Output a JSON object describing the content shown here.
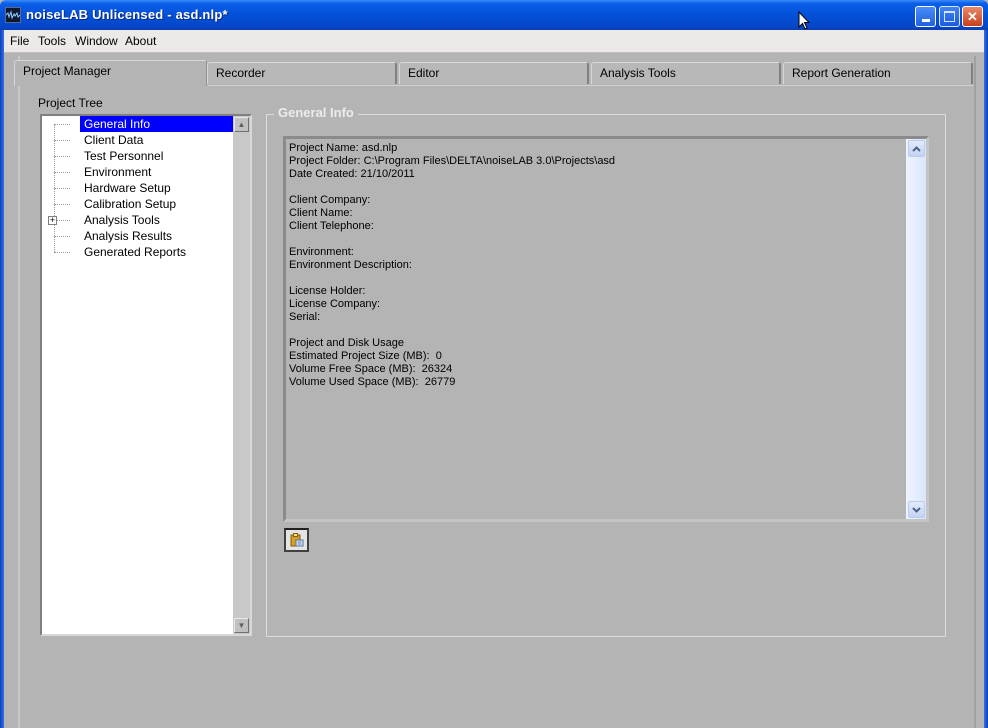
{
  "window": {
    "title": "noiseLAB Unlicensed - asd.nlp*",
    "icons": {
      "app": "noiselab-waveform-icon",
      "minimize": "minimize-icon",
      "maximize": "maximize-icon",
      "close": "close-icon"
    }
  },
  "menu": [
    "File",
    "Tools",
    "Window",
    "About"
  ],
  "tabs": [
    {
      "label": "Project Manager",
      "active": true
    },
    {
      "label": "Recorder",
      "active": false
    },
    {
      "label": "Editor",
      "active": false
    },
    {
      "label": "Analysis Tools",
      "active": false
    },
    {
      "label": "Report Generation",
      "active": false
    }
  ],
  "project_tree": {
    "label": "Project Tree",
    "selected": "General Info",
    "items": [
      {
        "label": "General Info",
        "expandable": false
      },
      {
        "label": "Client Data",
        "expandable": false
      },
      {
        "label": "Test Personnel",
        "expandable": false
      },
      {
        "label": "Environment",
        "expandable": false
      },
      {
        "label": "Hardware Setup",
        "expandable": false
      },
      {
        "label": "Calibration Setup",
        "expandable": false
      },
      {
        "label": "Analysis Tools",
        "expandable": true
      },
      {
        "label": "Analysis Results",
        "expandable": false
      },
      {
        "label": "Generated Reports",
        "expandable": false
      }
    ],
    "expander_symbol": "+"
  },
  "general_info": {
    "title": "General Info",
    "lines": [
      "Project Name: asd.nlp",
      "Project Folder: C:\\Program Files\\DELTA\\noiseLAB 3.0\\Projects\\asd",
      "Date Created: 21/10/2011",
      "",
      "Client Company:",
      "Client Name:",
      "Client Telephone:",
      "",
      "Environment:",
      "Environment Description:",
      "",
      "License Holder:",
      "License Company:",
      "Serial:",
      "",
      "Project and Disk Usage",
      "Estimated Project Size (MB):  0",
      "Volume Free Space (MB):  26324",
      "Volume Used Space (MB):  26779"
    ],
    "copy_button_icon": "clipboard-copy-icon"
  }
}
